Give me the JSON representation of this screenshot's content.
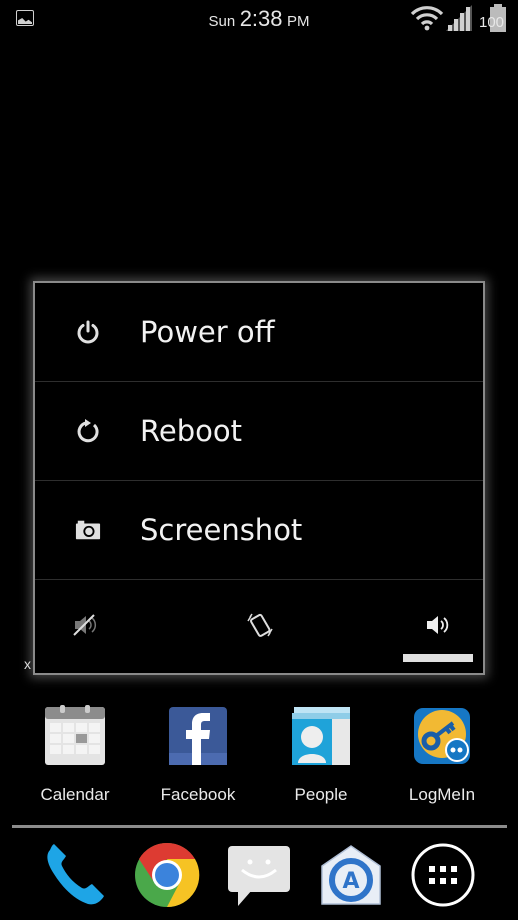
{
  "status_bar": {
    "day": "Sun",
    "time": "2:38",
    "ampm": "PM",
    "battery_level": "100",
    "icons": [
      "gallery-notification-icon",
      "wifi-icon",
      "signal-icon",
      "battery-icon"
    ]
  },
  "power_menu": {
    "items": [
      {
        "label": "Power off",
        "icon": "power-icon"
      },
      {
        "label": "Reboot",
        "icon": "reboot-icon"
      },
      {
        "label": "Screenshot",
        "icon": "camera-icon"
      }
    ],
    "sound_modes": [
      {
        "name": "silent",
        "icon": "mute-icon",
        "selected": false
      },
      {
        "name": "vibrate",
        "icon": "vibrate-icon",
        "selected": false
      },
      {
        "name": "sound",
        "icon": "volume-icon",
        "selected": true
      }
    ]
  },
  "overlay_mark": "x",
  "home_apps": [
    {
      "label": "Calendar",
      "icon": "calendar-icon"
    },
    {
      "label": "Facebook",
      "icon": "facebook-icon"
    },
    {
      "label": "People",
      "icon": "people-icon"
    },
    {
      "label": "LogMeIn",
      "icon": "logmein-icon"
    }
  ],
  "dock": [
    {
      "name": "Phone",
      "icon": "phone-icon"
    },
    {
      "name": "Chrome",
      "icon": "chrome-icon"
    },
    {
      "name": "Messaging",
      "icon": "messaging-icon"
    },
    {
      "name": "Email",
      "icon": "email-icon"
    },
    {
      "name": "All apps",
      "icon": "app-drawer-icon"
    }
  ],
  "colors": {
    "background": "#000000",
    "dialog_border": "#8a8a8a",
    "divider": "#2e2e2e",
    "facebook_blue": "#3b5998",
    "phone_blue": "#1ea5e6"
  }
}
